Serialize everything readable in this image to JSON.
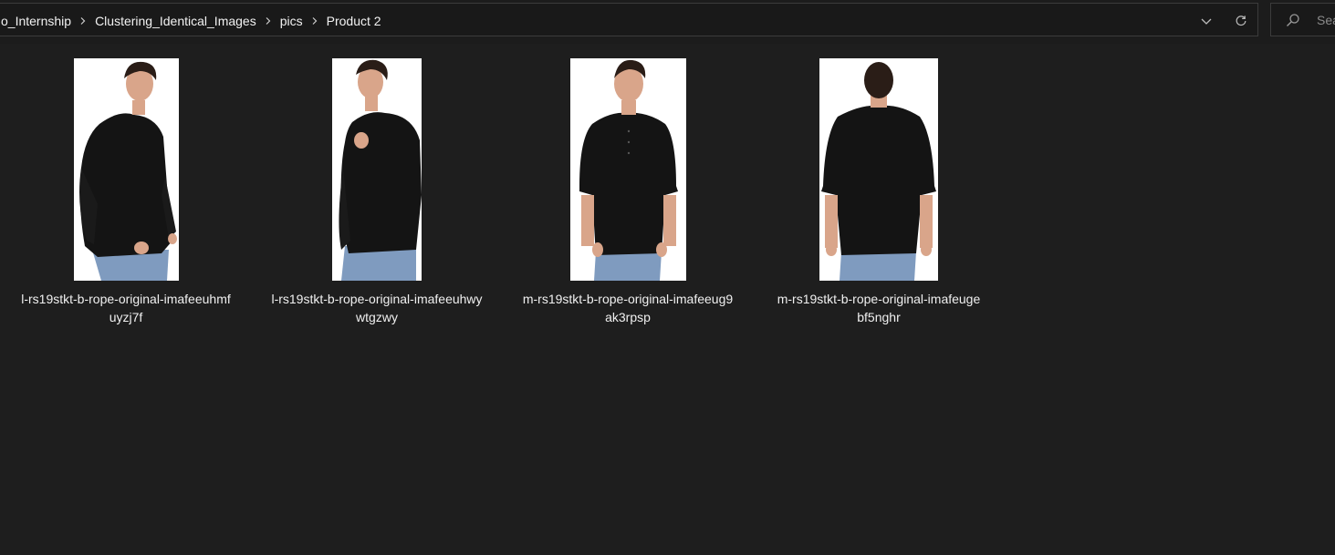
{
  "breadcrumb": {
    "items": [
      {
        "label": "o_Internship"
      },
      {
        "label": "Clustering_Identical_Images"
      },
      {
        "label": "pics"
      },
      {
        "label": "Product 2"
      }
    ],
    "separator_icon": "chevron-right-icon"
  },
  "address_controls": {
    "history_icon": "chevron-down-icon",
    "refresh_icon": "refresh-icon"
  },
  "search": {
    "placeholder": "Search",
    "icon": "search-icon"
  },
  "files": [
    {
      "name_line1": "l-rs19stkt-b-rope-original-imafeeuhmf",
      "name_line2": "uyzj7f",
      "pose": "three-quarter-left"
    },
    {
      "name_line1": "l-rs19stkt-b-rope-original-imafeeuhwy",
      "name_line2": "wtgzwy",
      "pose": "side-hand-on-chest"
    },
    {
      "name_line1": "m-rs19stkt-b-rope-original-imafeeug9",
      "name_line2": "ak3rpsp",
      "pose": "front"
    },
    {
      "name_line1": "m-rs19stkt-b-rope-original-imafeuge",
      "name_line2": "bf5nghr",
      "pose": "back"
    }
  ],
  "colors": {
    "background": "#1e1e1e",
    "shirt": "#141414",
    "jeans": "#7f9bbf",
    "skin": "#d9a58a",
    "hair": "#2a1d17"
  }
}
